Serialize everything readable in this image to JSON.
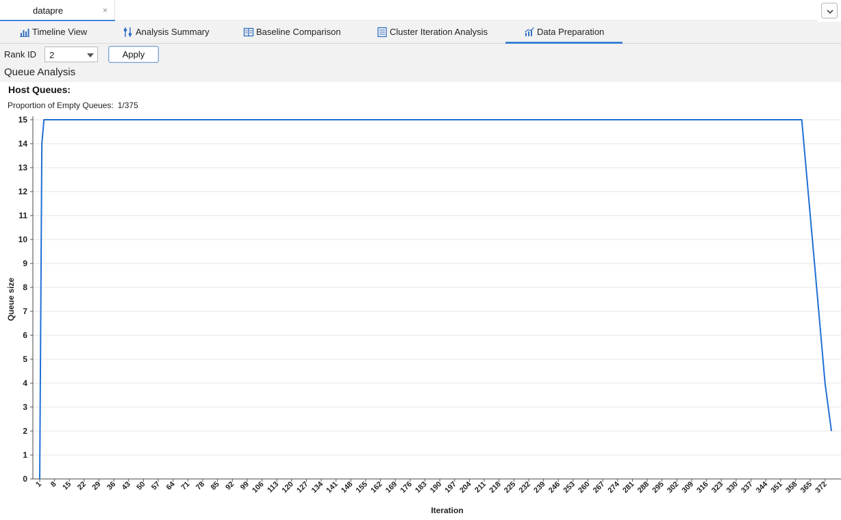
{
  "editor_tab": {
    "title": "datapre",
    "close_glyph": "×"
  },
  "view_tabs": [
    {
      "label": "Timeline View",
      "icon": "bar-chart-icon"
    },
    {
      "label": "Analysis Summary",
      "icon": "sliders-icon"
    },
    {
      "label": "Baseline Comparison",
      "icon": "compare-icon"
    },
    {
      "label": "Cluster Iteration Analysis",
      "icon": "table-icon"
    },
    {
      "label": "Data Preparation",
      "icon": "trend-chart-icon"
    }
  ],
  "toolbar": {
    "rank_label": "Rank ID",
    "rank_value": "2",
    "apply_label": "Apply"
  },
  "section_title": "Queue Analysis",
  "host_queues": {
    "title": "Host Queues:",
    "proportion_label": "Proportion of Empty Queues:",
    "proportion_value": "1/375"
  },
  "colors": {
    "accent": "#3d82d6",
    "line": "#1f6fd6",
    "grid": "#e6e6e6"
  },
  "chart_data": {
    "type": "line",
    "xlabel": "Iteration",
    "ylabel": "Queue size",
    "ylim": [
      0,
      15
    ],
    "yticks": [
      0,
      1,
      2,
      3,
      4,
      5,
      6,
      7,
      8,
      9,
      10,
      11,
      12,
      13,
      14,
      15
    ],
    "xlim": [
      1,
      375
    ],
    "xticks": [
      1,
      8,
      15,
      22,
      29,
      36,
      43,
      50,
      57,
      64,
      71,
      78,
      85,
      92,
      99,
      106,
      113,
      120,
      127,
      134,
      141,
      148,
      155,
      162,
      169,
      176,
      183,
      190,
      197,
      204,
      211,
      218,
      225,
      232,
      239,
      246,
      253,
      260,
      267,
      274,
      281,
      288,
      295,
      302,
      309,
      316,
      323,
      330,
      337,
      344,
      351,
      358,
      365,
      372
    ],
    "grid": "horizontal",
    "series": [
      {
        "x": [
          1,
          2,
          3,
          361,
          365,
          367,
          369,
          372,
          375
        ],
        "y": [
          0,
          14,
          15,
          15,
          11,
          9,
          7,
          4,
          2
        ]
      }
    ]
  }
}
